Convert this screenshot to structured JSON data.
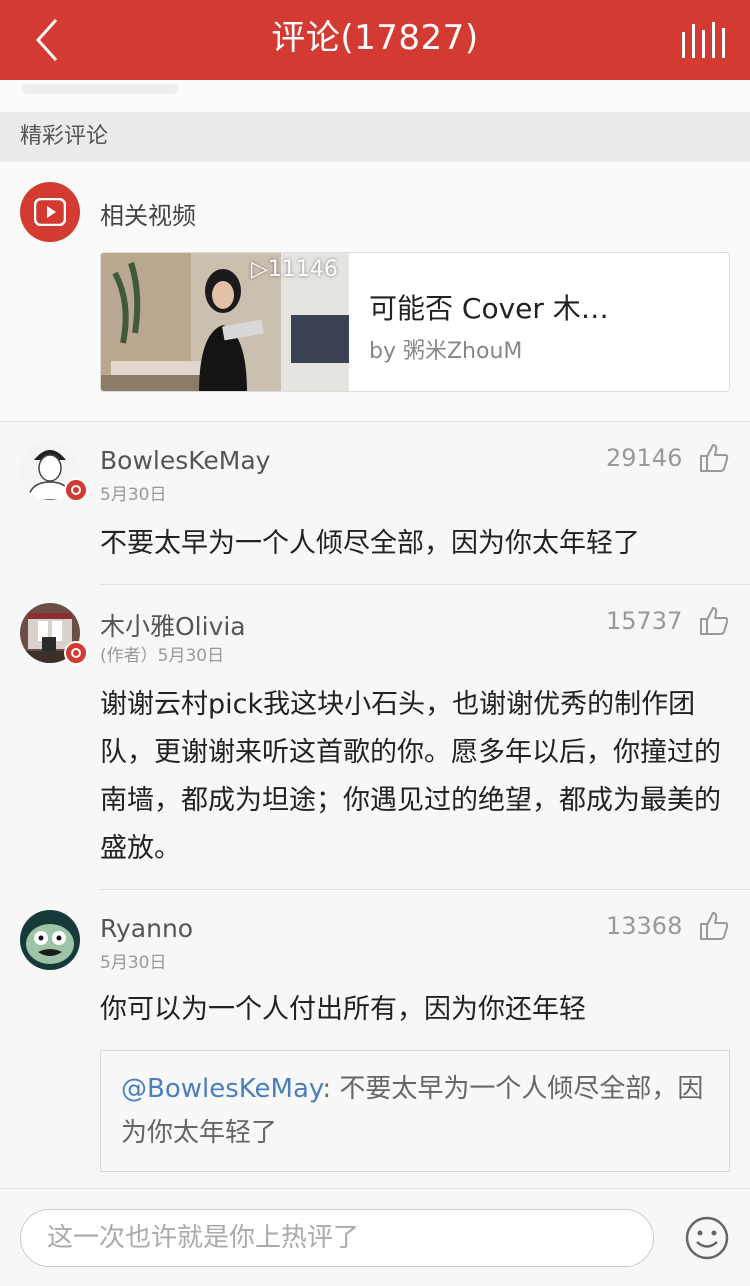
{
  "header": {
    "title": "评论(17827)"
  },
  "section": {
    "title": "精彩评论"
  },
  "related_video": {
    "label": "相关视频",
    "play_count": "▷11146",
    "title": "可能否 Cover 木…",
    "author": "by 粥米ZhouM"
  },
  "comments": [
    {
      "username": "BowlesKeMay",
      "date": "5月30日",
      "likes": "29146",
      "text": "不要太早为一个人倾尽全部，因为你太年轻了"
    },
    {
      "username": "木小雅Olivia",
      "date": "(作者）5月30日",
      "likes": "15737",
      "text": "谢谢云村pick我这块小石头，也谢谢优秀的制作团队，更谢谢来听这首歌的你。愿多年以后，你撞过的南墙，都成为坦途；你遇见过的绝望，都成为最美的盛放。"
    },
    {
      "username": "Ryanno",
      "date": "5月30日",
      "likes": "13368",
      "text": "你可以为一个人付出所有，因为你还年轻",
      "reply": {
        "mention": "@BowlesKeMay",
        "text": ": 不要太早为一个人倾尽全部，因为你太年轻了"
      }
    }
  ],
  "footer": {
    "placeholder": "这一次也许就是你上热评了"
  },
  "colors": {
    "brand_red": "#d33a31",
    "mention_blue": "#4a7fbe"
  },
  "icons": [
    "back-arrow-icon",
    "playing-bars-icon",
    "video-play-icon",
    "thumbs-up-icon",
    "emoji-smile-icon",
    "music-badge-icon"
  ]
}
